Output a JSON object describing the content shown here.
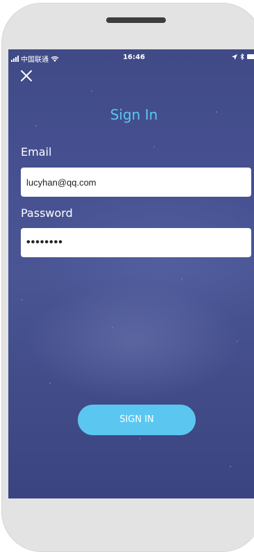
{
  "status_bar": {
    "carrier": "中国联通",
    "time": "16:46"
  },
  "header": {
    "title": "Sign In",
    "close_icon": "close-icon"
  },
  "form": {
    "email_label": "Email",
    "email_value": "lucyhan@qq.com",
    "password_label": "Password",
    "password_value": "••••••••"
  },
  "actions": {
    "signin_label": "SIGN IN"
  },
  "colors": {
    "accent": "#5bc7f0",
    "background": "#465091",
    "text": "#ffffff"
  }
}
